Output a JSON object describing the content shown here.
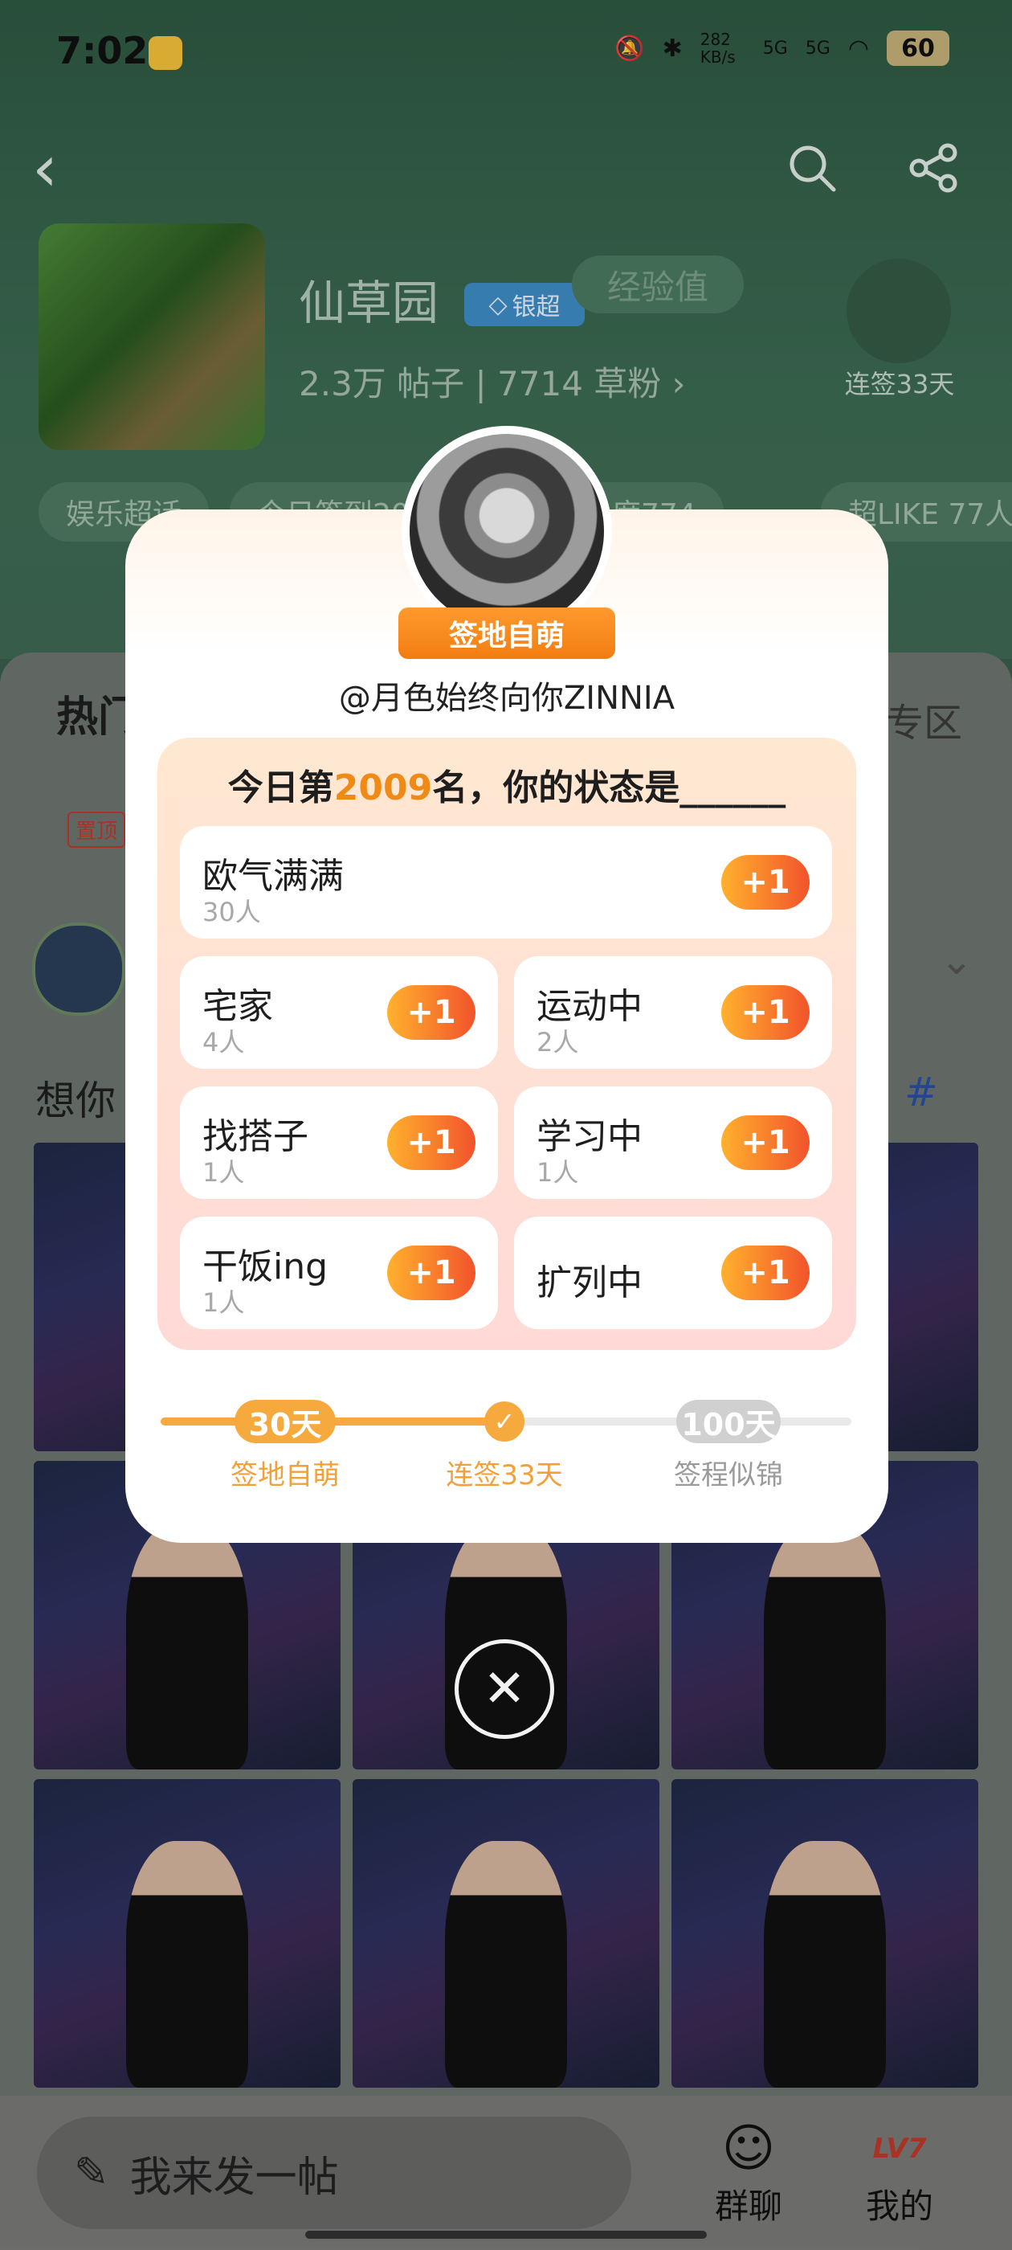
{
  "status_bar": {
    "time": "7:02",
    "net_speed": "282 KB/s",
    "signal1": "5G",
    "signal2": "5G",
    "battery": "60"
  },
  "header": {
    "title": "仙草园",
    "badge": "银超",
    "exp_pill": "经验值",
    "posts": "2.3万",
    "posts_label": "帖子",
    "fans": "7714",
    "fans_label": "草粉",
    "checkin_label": "连签33天"
  },
  "tags": [
    "娱乐超话",
    "今日签到20",
    "实时热度774",
    "超LIKE 77人"
  ],
  "tabs": {
    "hot": "热门",
    "right": "专区"
  },
  "pinned_label": "置顶",
  "post": {
    "text": "想你",
    "hashtag": "#"
  },
  "modal": {
    "ribbon": "签地自萌",
    "username": "@月色始终向你ZINNIA",
    "rank_prefix": "今日第",
    "rank": "2009",
    "rank_suffix": "名，你的状态是______",
    "statuses": [
      {
        "label": "欧气满满",
        "count": "30人"
      },
      {
        "label": "宅家",
        "count": "4人"
      },
      {
        "label": "运动中",
        "count": "2人"
      },
      {
        "label": "找搭子",
        "count": "1人"
      },
      {
        "label": "学习中",
        "count": "1人"
      },
      {
        "label": "干饭ing",
        "count": "1人"
      },
      {
        "label": "扩列中",
        "count": ""
      }
    ],
    "plus_label": "+1",
    "milestones": {
      "left_days": "30天",
      "left_label": "签地自萌",
      "middle_label": "连签33天",
      "right_days": "100天",
      "right_label": "签程似锦"
    },
    "progress_fraction": 0.5
  },
  "bottom": {
    "compose": "我来发一帖",
    "group_chat": "群聊",
    "mine": "我的",
    "level": "LV7"
  }
}
